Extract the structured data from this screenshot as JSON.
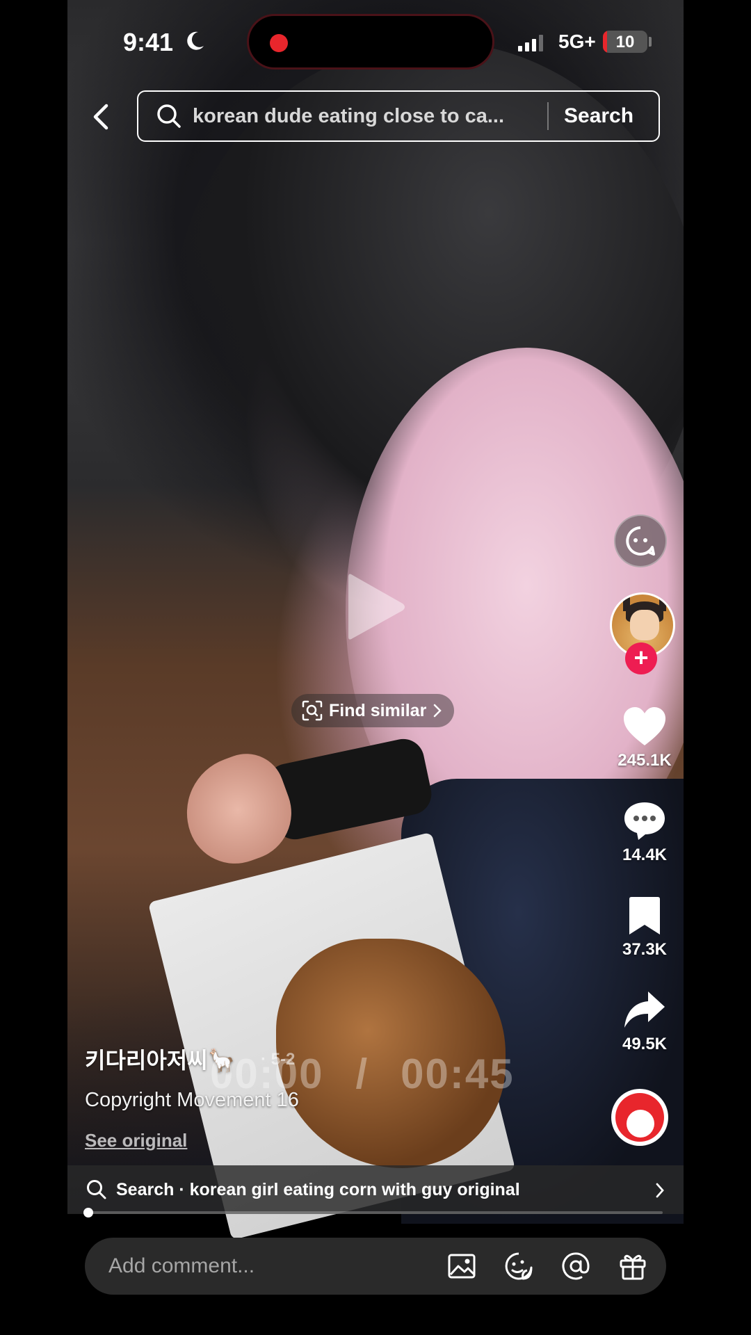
{
  "status_bar": {
    "time": "9:41",
    "network": "5G+",
    "battery": "10",
    "battery_level": 0.1,
    "recording_color": "#e8262c"
  },
  "header": {
    "search_query": "korean dude eating close to ca...",
    "search_button": "Search"
  },
  "center": {
    "find_similar_label": "Find similar"
  },
  "rail": {
    "likes": "245.1K",
    "comments": "14.4K",
    "bookmarks": "37.3K",
    "shares": "49.5K",
    "follow_symbol": "+",
    "icons": [
      "ai-face-icon",
      "heart-icon",
      "comment-bubble-icon",
      "bookmark-icon",
      "share-arrow-icon",
      "music-disc-icon"
    ]
  },
  "post": {
    "username": "키다리아저씨🦙",
    "date": "· 5-2",
    "caption": "Copyright Movement 16",
    "see_original": "See original",
    "time_current": "00:00",
    "time_separator": "/",
    "time_total": "00:45",
    "progress": 0.0
  },
  "related_search": {
    "text": "Search · korean girl eating corn with guy original"
  },
  "comment_bar": {
    "placeholder": "Add comment...",
    "icons": [
      "image-icon",
      "sticker-icon",
      "mention-icon",
      "gift-icon"
    ]
  },
  "colors": {
    "accent": "#ee1d52",
    "panel": "#2a2a2a"
  }
}
